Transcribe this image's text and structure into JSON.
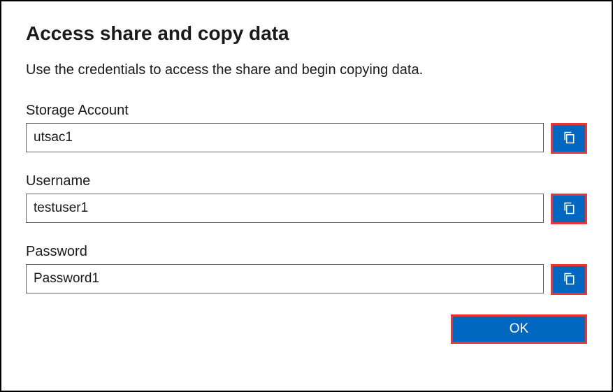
{
  "dialog": {
    "title": "Access share and copy data",
    "description": "Use the credentials to access the share and begin copying data."
  },
  "fields": {
    "storage_account": {
      "label": "Storage Account",
      "value": "utsac1"
    },
    "username": {
      "label": "Username",
      "value": "testuser1"
    },
    "password": {
      "label": "Password",
      "value": "Password1"
    }
  },
  "buttons": {
    "ok": "OK"
  }
}
